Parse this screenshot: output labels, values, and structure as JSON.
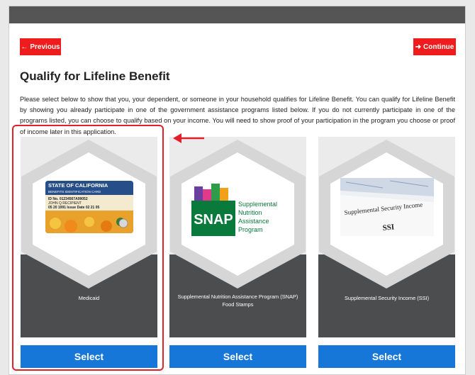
{
  "header": {
    "previous_label": "Previous",
    "continue_label": "Continue"
  },
  "page": {
    "title": "Qualify for Lifeline Benefit",
    "intro": "Please select below to show that you, your dependent, or someone in your household qualifies for Lifeline Benefit. You can qualify for Lifeline Benefit by showing you already participate in one of the government assistance programs listed below. If you do not currently participate in one of the programs listed, you can choose to qualify based on your income. You will need to show proof of your participation in the program you choose or proof of income later in this application."
  },
  "programs": [
    {
      "label": "Medicaid",
      "select_label": "Select",
      "card_text": {
        "line1": "STATE OF CALIFORNIA",
        "line2": "BENEFITS IDENTIFICATION CARD",
        "line3": "ID No. 01234567A99052",
        "line4": "JOHN Q RECIPIENT",
        "line5": "05 20 1991   Issue Date 02 21 05"
      }
    },
    {
      "label": "Supplemental Nutrition Assistance Program (SNAP) Food Stamps",
      "select_label": "Select",
      "logo_text": "SNAP",
      "logo_lines": [
        "Supplemental",
        "Nutrition",
        "Assistance",
        "Program"
      ]
    },
    {
      "label": "Supplemental Security Income (SSI)",
      "select_label": "Select",
      "doc_title": "Supplemental Security Income",
      "doc_abbr": "SSI"
    }
  ],
  "colors": {
    "accent_red": "#ee1c1c",
    "select_blue": "#1677d8",
    "card_dark": "#4b4d4f",
    "highlight_red": "#e0202a",
    "snap_green": "#0a7a3c"
  }
}
